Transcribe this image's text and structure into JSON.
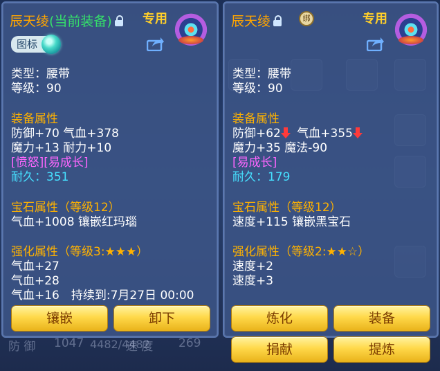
{
  "left": {
    "title": "辰天绫",
    "equipped": "(当前装备)",
    "exclusive": "专用",
    "tag": "图标",
    "type": "类型：腰带",
    "level": "等级：90",
    "attr_head": "装备属性",
    "attr_1": "防御+70 气血+378",
    "attr_2": "魔力+13 耐力+10",
    "special": "[愤怒][易成长]",
    "durability": "耐久：351",
    "gem_head": "宝石属性（等级12）",
    "gem_line": "气血+1008 镶嵌红玛瑙",
    "enhance_head": "强化属性（等级3:★★★）",
    "enhance_1": "气血+27",
    "enhance_2": "气血+28",
    "enhance_3": "气血+16　持续到:7月27日 00:00",
    "btn_inlay": "镶嵌",
    "btn_unequip": "卸下"
  },
  "right": {
    "title": "辰天绫",
    "seal": "绑",
    "exclusive": "专用",
    "type": "类型：腰带",
    "level": "等级：90",
    "attr_head": "装备属性",
    "attr_def": "防御+62",
    "attr_hp": "气血+355",
    "attr_2": "魔力+35 魔法-90",
    "special": "[易成长]",
    "durability": "耐久：179",
    "gem_head": "宝石属性（等级12）",
    "gem_line": "速度+115 镶嵌黑宝石",
    "enhance_head": "强化属性（等级2:★★☆）",
    "enhance_1": "速度+2",
    "enhance_2": "速度+3",
    "btn_refine": "炼化",
    "btn_equip": "装备",
    "btn_donate": "捐献",
    "btn_extract": "提炼"
  },
  "background": {
    "hp_text": "4482/4482",
    "bottom_def": "防 御",
    "bottom_def_val": "1047",
    "bottom_spd": "速 度",
    "bottom_spd_val": "269"
  }
}
